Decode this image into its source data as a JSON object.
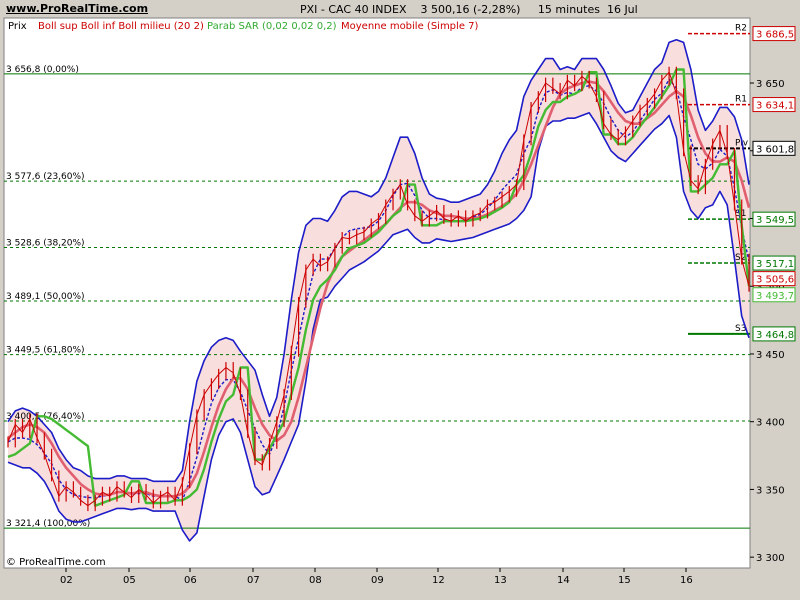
{
  "header": {
    "site": "www.ProRealTime.com",
    "title": "PXI - CAC 40 INDEX    3 500,16 (-2,28%)     15 minutes  16 Jul"
  },
  "legend": {
    "prix": "Prix",
    "boll": "Boll sup Boll inf Boll milieu (20 2)",
    "sar": "Parab SAR (0,02 0,02 0,2)",
    "mm": "Moyenne mobile (Simple 7)"
  },
  "copyright": "© ProRealTime.com",
  "colors": {
    "background": "#ffffff",
    "frame": "#d4d0c8",
    "price_candles": "#cc0000",
    "boll_band": "#1c1cc8",
    "boll_fill": "#f9dede",
    "sar": "#44bb33",
    "moving_average": "#e06070",
    "fib_line": "#007700",
    "pivot_red": "#cc0000"
  },
  "chart_data": {
    "type": "line",
    "title": "PXI - CAC 40 INDEX 3 500,16 (-2,28%) 15 minutes 16 Jul",
    "xlabel": "",
    "ylabel": "",
    "ylim": [
      3292,
      3698
    ],
    "x_ticks": [
      "02",
      "05",
      "06",
      "07",
      "08",
      "09",
      "12",
      "13",
      "14",
      "15",
      "16"
    ],
    "y_ticks": [
      "3 650",
      "3 600",
      "3 550",
      "3 500",
      "3 450",
      "3 400",
      "3 350",
      "3 300"
    ],
    "fibonacci_levels": [
      {
        "label": "3 656,8 (0,00%)",
        "value": 3656.8
      },
      {
        "label": "3 577,6 (23,60%)",
        "value": 3577.6
      },
      {
        "label": "3 528,6 (38,20%)",
        "value": 3528.6
      },
      {
        "label": "3 489,1 (50,00%)",
        "value": 3489.1
      },
      {
        "label": "3 449,5 (61,80%)",
        "value": 3449.5
      },
      {
        "label": "3 400,5 (76,40%)",
        "value": 3400.5
      },
      {
        "label": "3 321,4 (100,00%)",
        "value": 3321.4
      }
    ],
    "pivot_levels": [
      {
        "label": "R2",
        "value": 3686.5,
        "box": "3 686,5",
        "color": "#cc0000"
      },
      {
        "label": "R1",
        "value": 3634.1,
        "box": "3 634,1",
        "color": "#cc0000"
      },
      {
        "label": "Piv",
        "value": 3601.8,
        "box": "3 601,8",
        "color": "#000000"
      },
      {
        "label": "S1",
        "value": 3549.5,
        "box": "3 549,5",
        "color": "#007700"
      },
      {
        "label": "S2",
        "value": 3517.1,
        "box": "3 517,1",
        "color": "#007700"
      },
      {
        "label": "S3",
        "value": 3464.8,
        "box": "3 464,8",
        "color": "#007700"
      }
    ],
    "last_values": [
      {
        "box": "3 505,6",
        "value": 3505.6,
        "color": "#cc0000"
      },
      {
        "box": "3 493,7",
        "value": 3493.7,
        "color": "#44bb33"
      }
    ],
    "series": [
      {
        "name": "Prix",
        "values": [
          3385,
          3398,
          3392,
          3402,
          3388,
          3376,
          3360,
          3345,
          3352,
          3348,
          3342,
          3338,
          3342,
          3348,
          3345,
          3352,
          3348,
          3344,
          3350,
          3346,
          3340,
          3345,
          3348,
          3342,
          3355,
          3380,
          3405,
          3420,
          3428,
          3435,
          3440,
          3436,
          3420,
          3392,
          3372,
          3368,
          3384,
          3400,
          3420,
          3452,
          3488,
          3512,
          3520,
          3515,
          3518,
          3528,
          3536,
          3535,
          3538,
          3540,
          3546,
          3550,
          3560,
          3568,
          3575,
          3560,
          3552,
          3548,
          3552,
          3556,
          3550,
          3548,
          3552,
          3548,
          3552,
          3554,
          3560,
          3562,
          3566,
          3570,
          3575,
          3608,
          3632,
          3640,
          3650,
          3646,
          3642,
          3652,
          3648,
          3655,
          3650,
          3640,
          3620,
          3612,
          3608,
          3614,
          3622,
          3630,
          3635,
          3642,
          3652,
          3658,
          3642,
          3600,
          3578,
          3572,
          3590,
          3605,
          3615,
          3598,
          3560,
          3520,
          3500
        ]
      },
      {
        "name": "Boll sup",
        "values": [
          3400,
          3408,
          3410,
          3408,
          3404,
          3398,
          3392,
          3380,
          3372,
          3366,
          3364,
          3360,
          3358,
          3358,
          3358,
          3360,
          3360,
          3358,
          3358,
          3358,
          3356,
          3356,
          3356,
          3356,
          3364,
          3400,
          3430,
          3445,
          3455,
          3460,
          3462,
          3460,
          3452,
          3445,
          3438,
          3420,
          3404,
          3418,
          3450,
          3490,
          3525,
          3545,
          3550,
          3550,
          3548,
          3556,
          3566,
          3570,
          3570,
          3568,
          3566,
          3570,
          3580,
          3595,
          3610,
          3610,
          3598,
          3580,
          3568,
          3565,
          3564,
          3562,
          3562,
          3564,
          3566,
          3568,
          3575,
          3585,
          3598,
          3608,
          3615,
          3640,
          3652,
          3660,
          3668,
          3668,
          3660,
          3662,
          3660,
          3668,
          3668,
          3668,
          3660,
          3648,
          3635,
          3628,
          3630,
          3640,
          3650,
          3660,
          3665,
          3680,
          3682,
          3680,
          3660,
          3630,
          3615,
          3622,
          3632,
          3632,
          3625,
          3608,
          3575
        ]
      },
      {
        "name": "Boll inf",
        "values": [
          3370,
          3368,
          3366,
          3366,
          3362,
          3356,
          3346,
          3334,
          3328,
          3326,
          3326,
          3328,
          3330,
          3332,
          3334,
          3336,
          3336,
          3335,
          3336,
          3336,
          3334,
          3334,
          3334,
          3334,
          3320,
          3312,
          3318,
          3345,
          3372,
          3390,
          3400,
          3402,
          3392,
          3372,
          3352,
          3346,
          3348,
          3360,
          3372,
          3385,
          3398,
          3430,
          3468,
          3490,
          3492,
          3500,
          3506,
          3512,
          3515,
          3518,
          3522,
          3526,
          3532,
          3538,
          3540,
          3542,
          3536,
          3532,
          3532,
          3535,
          3534,
          3533,
          3534,
          3535,
          3536,
          3538,
          3540,
          3542,
          3544,
          3546,
          3550,
          3556,
          3566,
          3600,
          3618,
          3622,
          3622,
          3624,
          3624,
          3626,
          3628,
          3620,
          3610,
          3600,
          3595,
          3592,
          3598,
          3604,
          3610,
          3616,
          3620,
          3626,
          3610,
          3570,
          3556,
          3550,
          3558,
          3560,
          3570,
          3560,
          3520,
          3478,
          3462
        ]
      },
      {
        "name": "Parab SAR",
        "values": [
          3374,
          3376,
          3380,
          3384,
          3404,
          3404,
          3402,
          3398,
          3394,
          3390,
          3386,
          3382,
          3338,
          3340,
          3342,
          3344,
          3346,
          3356,
          3356,
          3340,
          3340,
          3340,
          3340,
          3342,
          3342,
          3345,
          3350,
          3365,
          3385,
          3402,
          3415,
          3420,
          3440,
          3440,
          3372,
          3372,
          3380,
          3390,
          3400,
          3420,
          3440,
          3468,
          3490,
          3500,
          3505,
          3512,
          3522,
          3528,
          3530,
          3532,
          3536,
          3540,
          3546,
          3552,
          3556,
          3575,
          3575,
          3545,
          3545,
          3545,
          3548,
          3548,
          3548,
          3548,
          3549,
          3550,
          3552,
          3555,
          3558,
          3562,
          3575,
          3582,
          3598,
          3618,
          3630,
          3636,
          3636,
          3640,
          3642,
          3645,
          3658,
          3658,
          3612,
          3612,
          3605,
          3605,
          3610,
          3618,
          3625,
          3632,
          3640,
          3648,
          3660,
          3660,
          3570,
          3570,
          3575,
          3580,
          3590,
          3590,
          3600,
          3545,
          3500
        ]
      },
      {
        "name": "Moyenne mobile",
        "values": [
          3388,
          3392,
          3396,
          3398,
          3396,
          3392,
          3384,
          3374,
          3366,
          3360,
          3354,
          3350,
          3347,
          3346,
          3346,
          3348,
          3348,
          3347,
          3348,
          3348,
          3346,
          3345,
          3345,
          3345,
          3347,
          3352,
          3362,
          3378,
          3396,
          3412,
          3424,
          3432,
          3432,
          3424,
          3410,
          3398,
          3390,
          3386,
          3390,
          3400,
          3418,
          3440,
          3462,
          3484,
          3502,
          3514,
          3522,
          3526,
          3530,
          3534,
          3538,
          3542,
          3546,
          3552,
          3558,
          3562,
          3562,
          3560,
          3556,
          3554,
          3552,
          3552,
          3551,
          3550,
          3550,
          3551,
          3553,
          3556,
          3559,
          3563,
          3568,
          3578,
          3590,
          3604,
          3618,
          3632,
          3642,
          3646,
          3648,
          3650,
          3651,
          3650,
          3644,
          3636,
          3628,
          3622,
          3620,
          3620,
          3624,
          3628,
          3634,
          3640,
          3644,
          3640,
          3626,
          3610,
          3598,
          3592,
          3592,
          3595,
          3592,
          3578,
          3558
        ]
      }
    ]
  }
}
